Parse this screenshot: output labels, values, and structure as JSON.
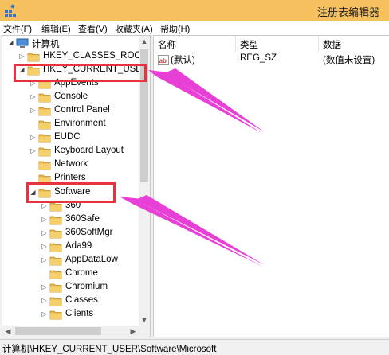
{
  "window": {
    "title": "注册表编辑器"
  },
  "menu": [
    "文件(F)",
    "编辑(E)",
    "查看(V)",
    "收藏夹(A)",
    "帮助(H)"
  ],
  "tree": {
    "root": "计算机",
    "items": [
      {
        "label": "HKEY_CLASSES_ROOT"
      },
      {
        "label": "HKEY_CURRENT_USER"
      },
      {
        "label": "AppEvents"
      },
      {
        "label": "Console"
      },
      {
        "label": "Control Panel"
      },
      {
        "label": "Environment"
      },
      {
        "label": "EUDC"
      },
      {
        "label": "Keyboard Layout"
      },
      {
        "label": "Network"
      },
      {
        "label": "Printers"
      },
      {
        "label": "Software"
      },
      {
        "label": "360"
      },
      {
        "label": "360Safe"
      },
      {
        "label": "360SoftMgr"
      },
      {
        "label": "Ada99"
      },
      {
        "label": "AppDataLow"
      },
      {
        "label": "Chrome"
      },
      {
        "label": "Chromium"
      },
      {
        "label": "Classes"
      },
      {
        "label": "Clients"
      }
    ]
  },
  "list": {
    "headers": {
      "name": "名称",
      "type": "类型",
      "data": "数据"
    },
    "rows": [
      {
        "name": "(默认)",
        "type": "REG_SZ",
        "data": "(数值未设置)"
      }
    ]
  },
  "status": "计算机\\HKEY_CURRENT_USER\\Software\\Microsoft",
  "colors": {
    "titlebar": "#f6c05e",
    "highlight": "#e8323c",
    "arrow": "#e83fd6",
    "folder": "#e8b84a"
  }
}
